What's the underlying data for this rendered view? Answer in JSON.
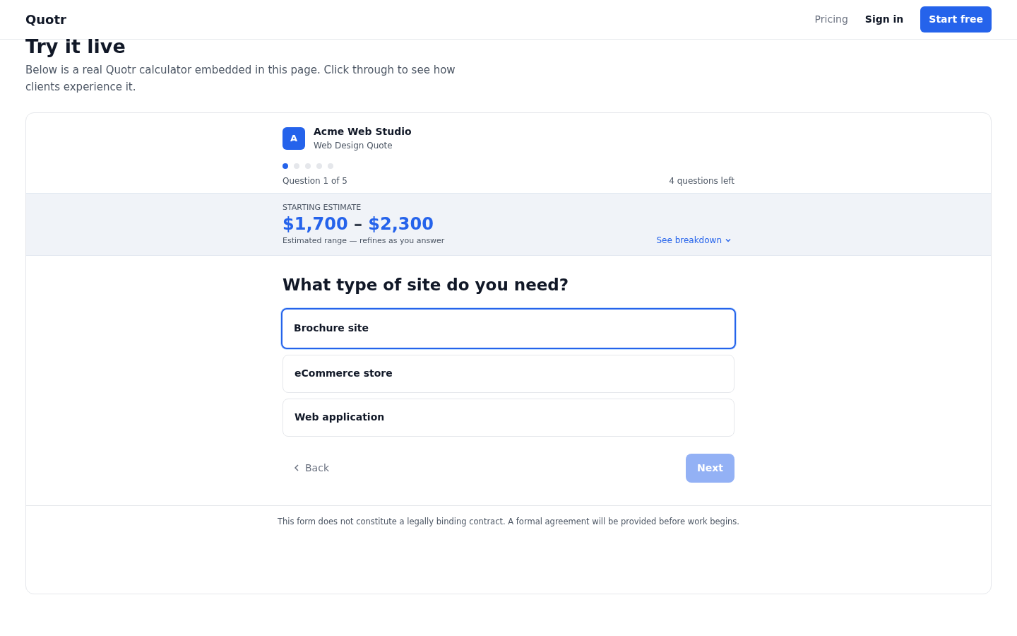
{
  "navbar": {
    "brand": "Quotr",
    "links": [
      {
        "label": "Pricing",
        "kind": "muted"
      },
      {
        "label": "Sign in",
        "kind": "strong"
      }
    ],
    "cta": "Start free"
  },
  "intro": {
    "title": "Try it live",
    "text": "Below is a real Quotr calculator embedded in this page. Click through to see how clients experience it."
  },
  "calculator": {
    "avatar": "A",
    "company": "Acme Web Studio",
    "subtitle": "Web Design Quote",
    "steps": [
      {
        "selected": true
      },
      {
        "selected": false
      },
      {
        "selected": false
      },
      {
        "selected": false
      },
      {
        "selected": false
      }
    ],
    "progress_label": "Question 1 of 5",
    "remaining": "4 questions left",
    "estimate": {
      "label": "STARTING ESTIMATE",
      "low": "$1,700",
      "separator": "–",
      "high": "$2,300",
      "note": "Estimated range — refines as you answer",
      "breakdown": "See breakdown"
    },
    "question": "What type of site do you need?",
    "options": [
      {
        "label": "Brochure site",
        "selected": true
      },
      {
        "label": "eCommerce store",
        "selected": false
      },
      {
        "label": "Web application",
        "selected": false
      }
    ],
    "back": "Back",
    "next": {
      "label": "Next",
      "disabled": true
    },
    "disclaimer": "This form does not constitute a legally binding contract. A formal agreement will be provided before work begins."
  }
}
